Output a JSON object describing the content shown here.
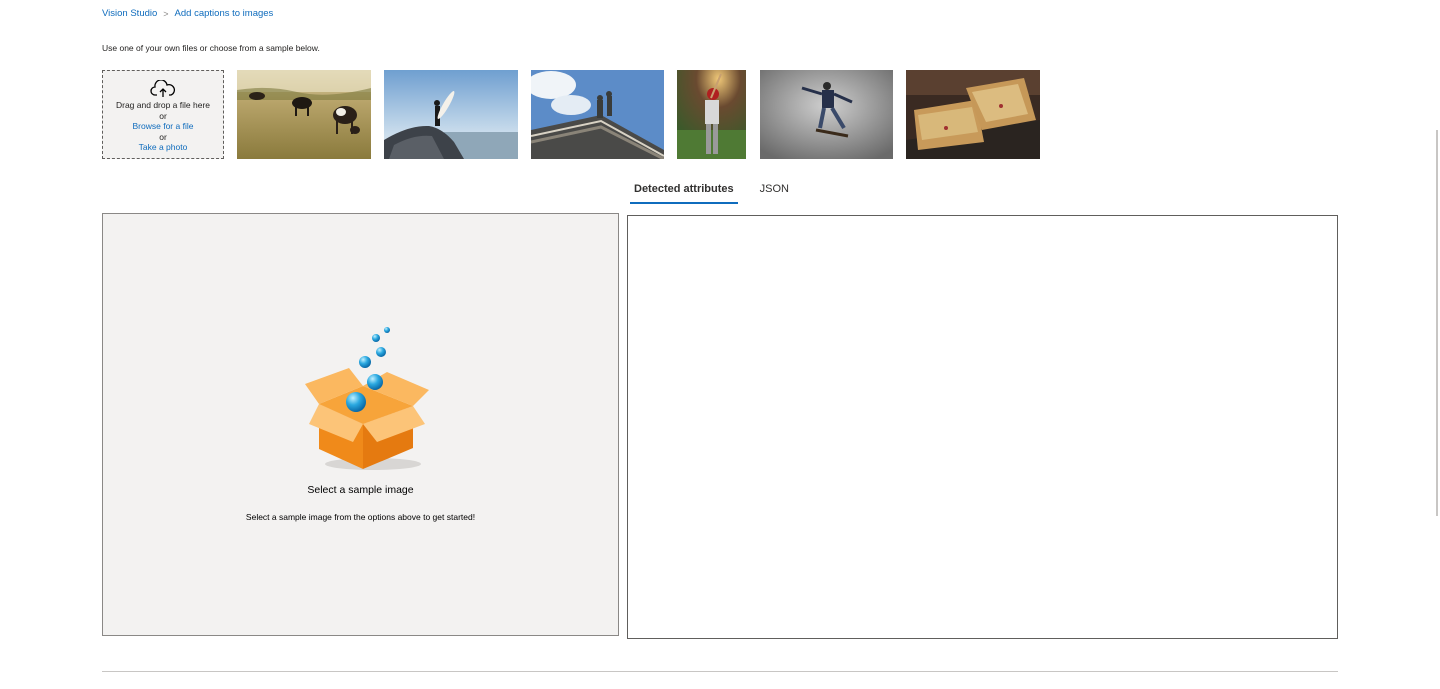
{
  "breadcrumb": {
    "root": "Vision Studio",
    "separator": ">",
    "current": "Add captions to images"
  },
  "instructions": "Use one of your own files or choose from a sample below.",
  "upload": {
    "icon": "cloud-upload-icon",
    "drag_text": "Drag and drop a file here",
    "or1": "or",
    "browse_link": "Browse for a file",
    "or2": "or",
    "photo_link": "Take a photo"
  },
  "samples": [
    {
      "name": "sample-cows"
    },
    {
      "name": "sample-surfer"
    },
    {
      "name": "sample-statues"
    },
    {
      "name": "sample-baseball"
    },
    {
      "name": "sample-skateboarder"
    },
    {
      "name": "sample-sandwich"
    }
  ],
  "tabs": [
    {
      "label": "Detected attributes",
      "active": true
    },
    {
      "label": "JSON",
      "active": false
    }
  ],
  "empty_state": {
    "icon": "open-box-icon",
    "title": "Select a sample image",
    "subtitle": "Select a sample image from the options above to get started!"
  },
  "colors": {
    "accent": "#0f6cbd",
    "panel_bg": "#f3f2f1",
    "box_orange": "#f7941d"
  }
}
